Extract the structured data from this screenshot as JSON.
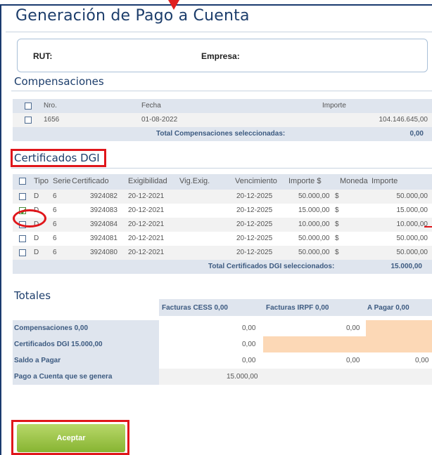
{
  "page": {
    "title": "Generación de Pago a Cuenta"
  },
  "info": {
    "rut_label": "RUT:",
    "empresa_label": "Empresa:"
  },
  "compensaciones": {
    "heading": "Compensaciones",
    "columns": [
      "Nro.",
      "Fecha",
      "Importe"
    ],
    "rows": [
      {
        "checked": false,
        "nro": "1656",
        "fecha": "01-08-2022",
        "importe": "104.146.645,00"
      }
    ],
    "total_label": "Total Compensaciones seleccionadas:",
    "total_value": "0,00"
  },
  "certificados": {
    "heading": "Certificados DGI",
    "columns": [
      "Tipo",
      "Serie",
      "Certificado",
      "Exigibilidad",
      "Vig.Exig.",
      "Vencimiento",
      "Importe $",
      "Moneda",
      "Importe"
    ],
    "rows": [
      {
        "checked": false,
        "tipo": "D",
        "serie": "6",
        "certificado": "3924082",
        "exigibilidad": "20-12-2021",
        "vig": "",
        "vencimiento": "20-12-2025",
        "importe_pesos": "50.000,00",
        "moneda": "$",
        "importe": "50.000,00"
      },
      {
        "checked": true,
        "tipo": "D",
        "serie": "6",
        "certificado": "3924083",
        "exigibilidad": "20-12-2021",
        "vig": "",
        "vencimiento": "20-12-2025",
        "importe_pesos": "15.000,00",
        "moneda": "$",
        "importe": "15.000,00"
      },
      {
        "checked": false,
        "tipo": "D",
        "serie": "6",
        "certificado": "3924084",
        "exigibilidad": "20-12-2021",
        "vig": "",
        "vencimiento": "20-12-2025",
        "importe_pesos": "10.000,00",
        "moneda": "$",
        "importe": "10.000,00"
      },
      {
        "checked": false,
        "tipo": "D",
        "serie": "6",
        "certificado": "3924081",
        "exigibilidad": "20-12-2021",
        "vig": "",
        "vencimiento": "20-12-2025",
        "importe_pesos": "50.000,00",
        "moneda": "$",
        "importe": "50.000,00"
      },
      {
        "checked": false,
        "tipo": "D",
        "serie": "6",
        "certificado": "3924080",
        "exigibilidad": "20-12-2021",
        "vig": "",
        "vencimiento": "20-12-2025",
        "importe_pesos": "50.000,00",
        "moneda": "$",
        "importe": "50.000,00"
      }
    ],
    "total_label": "Total Certificados DGI seleccionados:",
    "total_value": "15.000,00"
  },
  "totales": {
    "heading": "Totales",
    "columns": [
      "Facturas CESS  0,00",
      "Facturas IRPF  0,00",
      "A Pagar  0,00"
    ],
    "rows": [
      {
        "label": "Compensaciones  0,00",
        "cess": "0,00",
        "irpf": "0,00",
        "pagar": ""
      },
      {
        "label": "Certificados DGI  15.000,00",
        "cess": "0,00",
        "irpf": "",
        "pagar": ""
      },
      {
        "label": "Saldo a Pagar",
        "cess": "0,00",
        "irpf": "0,00",
        "pagar": "0,00"
      },
      {
        "label": "Pago a Cuenta que se genera",
        "cess": "15.000,00",
        "irpf": "",
        "pagar": ""
      }
    ]
  },
  "actions": {
    "accept_label": "Aceptar"
  },
  "colors": {
    "accent": "#1c3d6b",
    "highlight": "#e0161b",
    "button": "#87b432",
    "peach": "#fcd8b6"
  }
}
